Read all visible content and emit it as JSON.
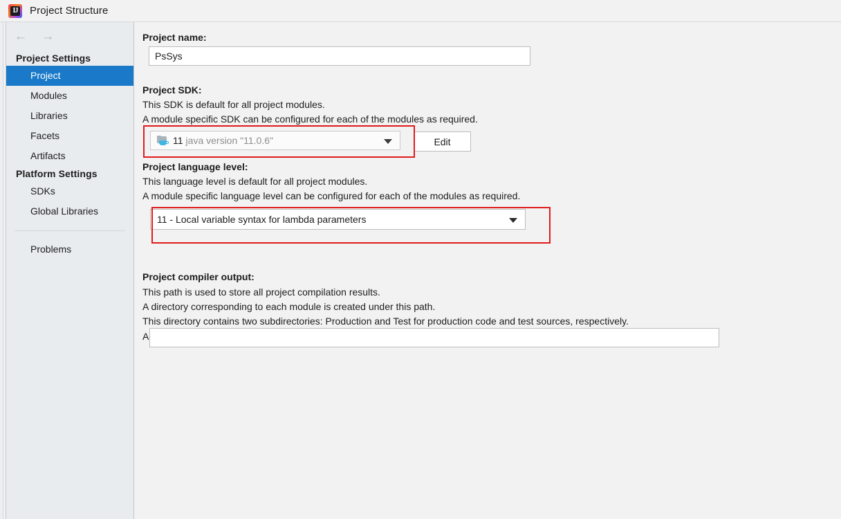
{
  "window": {
    "title": "Project Structure",
    "app_icon": "intellij-idea-icon",
    "icon_glyph": "IJ"
  },
  "nav": {
    "back_icon": "arrow-left-icon",
    "back_glyph": "←",
    "forward_icon": "arrow-right-icon",
    "forward_glyph": "→"
  },
  "sidebar": {
    "groups": [
      {
        "title": "Project Settings",
        "items": [
          {
            "label": "Project",
            "selected": true
          },
          {
            "label": "Modules",
            "selected": false
          },
          {
            "label": "Libraries",
            "selected": false
          },
          {
            "label": "Facets",
            "selected": false
          },
          {
            "label": "Artifacts",
            "selected": false
          }
        ]
      },
      {
        "title": "Platform Settings",
        "items": [
          {
            "label": "SDKs",
            "selected": false
          },
          {
            "label": "Global Libraries",
            "selected": false
          }
        ]
      }
    ],
    "footer_items": [
      {
        "label": "Problems",
        "selected": false
      }
    ]
  },
  "main": {
    "project_name": {
      "label": "Project name:",
      "value": "PsSys",
      "placeholder": ""
    },
    "project_sdk": {
      "label": "Project SDK:",
      "description_lines": [
        "This SDK is default for all project modules.",
        "A module specific SDK can be configured for each of the modules as required."
      ],
      "selected_version": "11",
      "selected_description": "java version \"11.0.6\"",
      "icon": "jdk-folder-icon",
      "edit_button": "Edit",
      "highlighted": true
    },
    "language_level": {
      "label": "Project language level:",
      "description_lines": [
        "This language level is default for all project modules.",
        "A module specific language level can be configured for each of the modules as required."
      ],
      "selected": "11 - Local variable syntax for lambda parameters",
      "highlighted": true
    },
    "compiler_output": {
      "label": "Project compiler output:",
      "description_lines": [
        "This path is used to store all project compilation results.",
        "A directory corresponding to each module is created under this path.",
        "This directory contains two subdirectories: Production and Test for production code and test sources, respectively.",
        "A module specific compiler output path can be configured for each of the modules as required."
      ],
      "value": "",
      "placeholder": "",
      "browse_icon": "folder-browse-icon"
    }
  },
  "colors": {
    "selection_blue": "#1a7ac9",
    "annotation_red": "#e01a1a",
    "sidebar_bg": "#e8ecef",
    "main_bg": "#f2f2f2",
    "muted_text": "#8d8d8d"
  }
}
